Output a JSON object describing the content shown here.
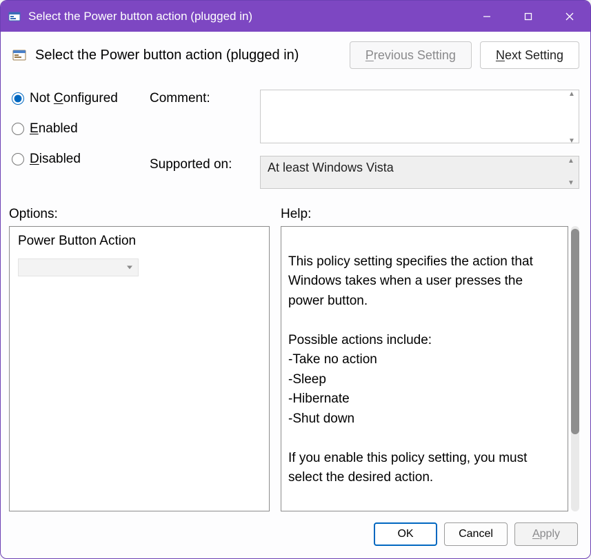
{
  "window": {
    "title": "Select the Power button action (plugged in)"
  },
  "header": {
    "policy_title": "Select the Power button action (plugged in)",
    "prev_prefix": "P",
    "prev_rest": "revious Setting",
    "next_prefix": "N",
    "next_rest": "ext Setting"
  },
  "state": {
    "not_configured_prefix": "Not ",
    "not_configured_letter": "C",
    "not_configured_rest": "onfigured",
    "enabled_letter": "E",
    "enabled_rest": "nabled",
    "disabled_letter": "D",
    "disabled_rest": "isabled",
    "selected": "not_configured"
  },
  "labels": {
    "comment": "Comment:",
    "supported": "Supported on:",
    "options": "Options:",
    "help": "Help:"
  },
  "fields": {
    "comment_value": "",
    "supported_value": "At least Windows Vista"
  },
  "options": {
    "dropdown_label": "Power Button Action",
    "dropdown_value": ""
  },
  "help": {
    "text": "This policy setting specifies the action that Windows takes when a user presses the power button.\n\nPossible actions include:\n-Take no action\n-Sleep\n-Hibernate\n-Shut down\n\nIf you enable this policy setting, you must select the desired action."
  },
  "footer": {
    "ok": "OK",
    "cancel": "Cancel",
    "apply_letter": "A",
    "apply_rest": "pply"
  }
}
